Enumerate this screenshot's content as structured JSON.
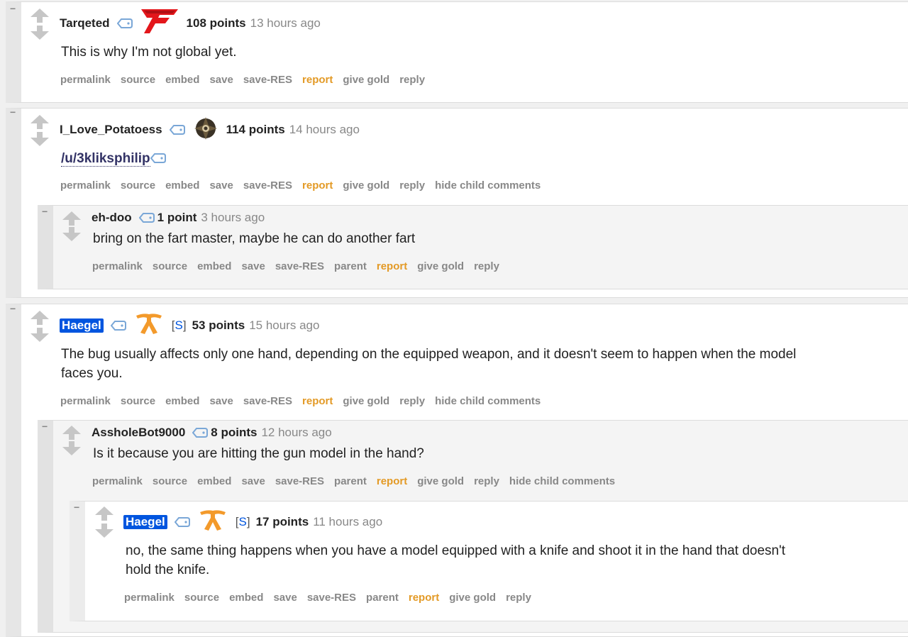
{
  "icons": {
    "collapse": "−",
    "upvote": "up-arrow-icon",
    "downvote": "down-arrow-icon",
    "tag": "tag-icon"
  },
  "comments": [
    {
      "author": "Tarqeted",
      "flair": "faze-logo",
      "score": "108 points",
      "time": "13 hours ago",
      "body": "This is why I'm not global yet.",
      "buttons": [
        "permalink",
        "source",
        "embed",
        "save",
        "save-RES",
        "report",
        "give gold",
        "reply"
      ]
    },
    {
      "author": "I_Love_Potatoess",
      "flair": "ninjas-in-pyjamas-logo",
      "score": "114 points",
      "time": "14 hours ago",
      "body": "/u/3kliksphilip",
      "buttons": [
        "permalink",
        "source",
        "embed",
        "save",
        "save-RES",
        "report",
        "give gold",
        "reply",
        "hide child comments"
      ]
    },
    {
      "author": "eh-doo",
      "score": "1 point",
      "time": "3 hours ago",
      "body": "bring on the fart master, maybe he can do another fart",
      "buttons": [
        "permalink",
        "source",
        "embed",
        "save",
        "save-RES",
        "parent",
        "report",
        "give gold",
        "reply"
      ]
    },
    {
      "author": "Haegel",
      "flair": "fnatic-logo",
      "submitter_tag": "S",
      "score": "53 points",
      "time": "15 hours ago",
      "body_line1": "The bug usually affects only one hand, depending on the equipped weapon, and it doesn't seem to happen when the model",
      "body_line2": "faces you.",
      "buttons": [
        "permalink",
        "source",
        "embed",
        "save",
        "save-RES",
        "report",
        "give gold",
        "reply",
        "hide child comments"
      ]
    },
    {
      "author": "AssholeBot9000",
      "score": "8 points",
      "time": "12 hours ago",
      "body": "Is it because you are hitting the gun model in the hand?",
      "buttons": [
        "permalink",
        "source",
        "embed",
        "save",
        "save-RES",
        "parent",
        "report",
        "give gold",
        "reply",
        "hide child comments"
      ]
    },
    {
      "author": "Haegel",
      "flair": "fnatic-logo",
      "submitter_tag": "S",
      "score": "17 points",
      "time": "11 hours ago",
      "body_line1": "no, the same thing happens when you have a model equipped with a knife and shoot it in the hand that doesn't",
      "body_line2": "hold the knife.",
      "buttons": [
        "permalink",
        "source",
        "embed",
        "save",
        "save-RES",
        "parent",
        "report",
        "give gold",
        "reply"
      ]
    }
  ],
  "colors": {
    "report": "#e39a26",
    "submitter_bg": "#0055df",
    "meta": "#888888"
  }
}
